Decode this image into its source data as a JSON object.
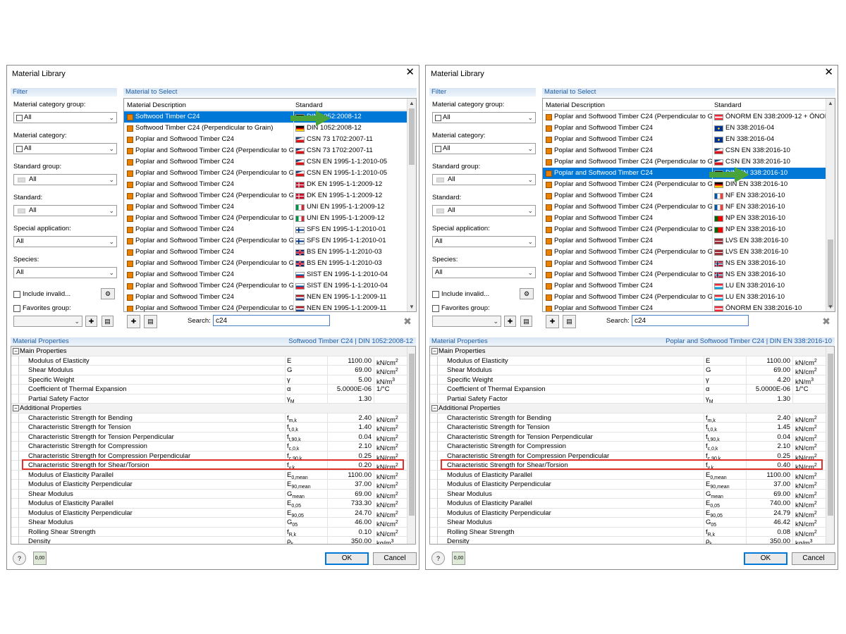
{
  "dialogs": [
    {
      "title": "Material Library",
      "filter": {
        "panel_title": "Filter",
        "labels": [
          "Material category group:",
          "Material category:",
          "Standard group:",
          "Standard:",
          "Special application:",
          "Species:"
        ],
        "values": [
          "All",
          "All",
          "All",
          "All",
          "All",
          "All"
        ],
        "include_invalid": "Include invalid...",
        "favorites_group": "Favorites group:"
      },
      "materials": {
        "panel_title": "Material to Select",
        "col_desc": "Material Description",
        "col_std": "Standard",
        "rows": [
          {
            "desc": "Softwood Timber C24",
            "std": "DIN 1052:2008-12",
            "flag": "DE",
            "sel": true
          },
          {
            "desc": "Softwood Timber C24 (Perpendicular to Grain)",
            "std": "DIN 1052:2008-12",
            "flag": "DE"
          },
          {
            "desc": "Poplar and Softwood Timber C24",
            "std": "CSN 73 1702:2007-11",
            "flag": "CZ"
          },
          {
            "desc": "Poplar and Softwood Timber C24 (Perpendicular to Gra",
            "std": "CSN 73 1702:2007-11",
            "flag": "CZ"
          },
          {
            "desc": "Poplar and Softwood Timber C24",
            "std": "CSN EN 1995-1-1:2010-05",
            "flag": "CZ"
          },
          {
            "desc": "Poplar and Softwood Timber C24 (Perpendicular to Gra",
            "std": "CSN EN 1995-1-1:2010-05",
            "flag": "CZ"
          },
          {
            "desc": "Poplar and Softwood Timber C24",
            "std": "DK EN 1995-1-1:2009-12",
            "flag": "DK"
          },
          {
            "desc": "Poplar and Softwood Timber C24 (Perpendicular to Gra",
            "std": "DK EN 1995-1-1:2009-12",
            "flag": "DK"
          },
          {
            "desc": "Poplar and Softwood Timber C24",
            "std": "UNI EN 1995-1-1:2009-12",
            "flag": "IT"
          },
          {
            "desc": "Poplar and Softwood Timber C24 (Perpendicular to Gra",
            "std": "UNI EN 1995-1-1:2009-12",
            "flag": "IT"
          },
          {
            "desc": "Poplar and Softwood Timber C24",
            "std": "SFS EN 1995-1-1:2010-01",
            "flag": "FI"
          },
          {
            "desc": "Poplar and Softwood Timber C24 (Perpendicular to Gra",
            "std": "SFS EN 1995-1-1:2010-01",
            "flag": "FI"
          },
          {
            "desc": "Poplar and Softwood Timber C24",
            "std": "BS EN 1995-1-1:2010-03",
            "flag": "GB"
          },
          {
            "desc": "Poplar and Softwood Timber C24 (Perpendicular to Gra",
            "std": "BS EN 1995-1-1:2010-03",
            "flag": "GB"
          },
          {
            "desc": "Poplar and Softwood Timber C24",
            "std": "SIST EN 1995-1-1:2010-04",
            "flag": "SI"
          },
          {
            "desc": "Poplar and Softwood Timber C24 (Perpendicular to Gra",
            "std": "SIST EN 1995-1-1:2010-04",
            "flag": "SI"
          },
          {
            "desc": "Poplar and Softwood Timber C24",
            "std": "NEN EN 1995-1-1:2009-11",
            "flag": "NL"
          },
          {
            "desc": "Poplar and Softwood Timber C24 (Perpendicular to Gra",
            "std": "NEN EN 1995-1-1:2009-11",
            "flag": "NL"
          }
        ]
      },
      "search_label": "Search:",
      "search_value": "c24",
      "props": {
        "panel_title": "Material Properties",
        "header_right": "Softwood Timber C24  |  DIN 1052:2008-12",
        "rows": [
          {
            "g": true,
            "name": "Main Properties"
          },
          {
            "name": "Modulus of Elasticity",
            "sym": "E",
            "val": "1100.00",
            "unit": "kN/cm²"
          },
          {
            "name": "Shear Modulus",
            "sym": "G",
            "val": "69.00",
            "unit": "kN/cm²"
          },
          {
            "name": "Specific Weight",
            "sym": "γ",
            "val": "5.00",
            "unit": "kN/m³"
          },
          {
            "name": "Coefficient of Thermal Expansion",
            "sym": "α",
            "val": "5.0000E-06",
            "unit": "1/°C"
          },
          {
            "name": "Partial Safety Factor",
            "sym": "γM",
            "val": "1.30",
            "unit": ""
          },
          {
            "g": true,
            "name": "Additional Properties"
          },
          {
            "name": "Characteristic Strength for Bending",
            "sym": "fm,k",
            "val": "2.40",
            "unit": "kN/cm²"
          },
          {
            "name": "Characteristic Strength for Tension",
            "sym": "ft,0,k",
            "val": "1.40",
            "unit": "kN/cm²"
          },
          {
            "name": "Characteristic Strength for Tension Perpendicular",
            "sym": "ft,90,k",
            "val": "0.04",
            "unit": "kN/cm²"
          },
          {
            "name": "Characteristic Strength for Compression",
            "sym": "fc,0,k",
            "val": "2.10",
            "unit": "kN/cm²"
          },
          {
            "name": "Characteristic Strength for Compression Perpendicular",
            "sym": "fc,90,k",
            "val": "0.25",
            "unit": "kN/cm²"
          },
          {
            "name": "Characteristic Strength for Shear/Torsion",
            "sym": "fv,k",
            "val": "0.20",
            "unit": "kN/cm²"
          },
          {
            "name": "Modulus of Elasticity Parallel",
            "sym": "E0,mean",
            "val": "1100.00",
            "unit": "kN/cm²"
          },
          {
            "name": "Modulus of Elasticity Perpendicular",
            "sym": "E90,mean",
            "val": "37.00",
            "unit": "kN/cm²"
          },
          {
            "name": "Shear Modulus",
            "sym": "Gmean",
            "val": "69.00",
            "unit": "kN/cm²"
          },
          {
            "name": "Modulus of Elasticity Parallel",
            "sym": "E0,05",
            "val": "733.30",
            "unit": "kN/cm²"
          },
          {
            "name": "Modulus of Elasticity Perpendicular",
            "sym": "E90,05",
            "val": "24.70",
            "unit": "kN/cm²"
          },
          {
            "name": "Shear Modulus",
            "sym": "G05",
            "val": "46.00",
            "unit": "kN/cm²"
          },
          {
            "name": "Rolling Shear Strength",
            "sym": "fR,k",
            "val": "0.10",
            "unit": "kN/cm²"
          },
          {
            "name": "Density",
            "sym": "ρk",
            "val": "350.00",
            "unit": "kg/m³"
          }
        ]
      },
      "ok": "OK",
      "cancel": "Cancel"
    },
    {
      "title": "Material Library",
      "filter": {
        "panel_title": "Filter",
        "labels": [
          "Material category group:",
          "Material category:",
          "Standard group:",
          "Standard:",
          "Special application:",
          "Species:"
        ],
        "values": [
          "All",
          "All",
          "All",
          "All",
          "All",
          "All"
        ],
        "include_invalid": "Include invalid...",
        "favorites_group": "Favorites group:"
      },
      "materials": {
        "panel_title": "Material to Select",
        "col_desc": "Material Description",
        "col_std": "Standard",
        "rows": [
          {
            "desc": "Poplar and Softwood Timber C24 (Perpendicular to Gra",
            "std": "ÖNORM EN 338:2009-12 + ÖNOR",
            "flag": "AT"
          },
          {
            "desc": "Poplar and Softwood Timber C24",
            "std": "EN 338:2016-04",
            "flag": "EU"
          },
          {
            "desc": "Poplar and Softwood Timber C24",
            "std": "EN 338:2016-04",
            "flag": "EU"
          },
          {
            "desc": "Poplar and Softwood Timber C24",
            "std": "CSN EN 338:2016-10",
            "flag": "CZ"
          },
          {
            "desc": "Poplar and Softwood Timber C24 (Perpendicular to Gra",
            "std": "CSN EN 338:2016-10",
            "flag": "CZ"
          },
          {
            "desc": "Poplar and Softwood Timber C24",
            "std": "DIN EN 338:2016-10",
            "flag": "DE",
            "sel": true
          },
          {
            "desc": "Poplar and Softwood Timber C24 (Perpendicular to Gra",
            "std": "DIN EN 338:2016-10",
            "flag": "DE"
          },
          {
            "desc": "Poplar and Softwood Timber C24",
            "std": "NF EN 338:2016-10",
            "flag": "FR"
          },
          {
            "desc": "Poplar and Softwood Timber C24 (Perpendicular to Gra",
            "std": "NF EN 338:2016-10",
            "flag": "FR"
          },
          {
            "desc": "Poplar and Softwood Timber C24",
            "std": "NP EN 338:2016-10",
            "flag": "PT"
          },
          {
            "desc": "Poplar and Softwood Timber C24 (Perpendicular to Gra",
            "std": "NP EN 338:2016-10",
            "flag": "PT"
          },
          {
            "desc": "Poplar and Softwood Timber C24",
            "std": "LVS EN 338:2016-10",
            "flag": "LV"
          },
          {
            "desc": "Poplar and Softwood Timber C24 (Perpendicular to Gra",
            "std": "LVS EN 338:2016-10",
            "flag": "LV"
          },
          {
            "desc": "Poplar and Softwood Timber C24",
            "std": "NS EN 338:2016-10",
            "flag": "NO"
          },
          {
            "desc": "Poplar and Softwood Timber C24 (Perpendicular to Gra",
            "std": "NS EN 338:2016-10",
            "flag": "NO"
          },
          {
            "desc": "Poplar and Softwood Timber C24",
            "std": "LU EN 338:2016-10",
            "flag": "LU"
          },
          {
            "desc": "Poplar and Softwood Timber C24 (Perpendicular to Gra",
            "std": "LU EN 338:2016-10",
            "flag": "LU"
          },
          {
            "desc": "Poplar and Softwood Timber C24",
            "std": "ÖNORM EN 338:2016-10",
            "flag": "AT"
          }
        ]
      },
      "search_label": "Search:",
      "search_value": "c24",
      "props": {
        "panel_title": "Material Properties",
        "header_right": "Poplar and Softwood Timber C24  |  DIN EN 338:2016-10",
        "rows": [
          {
            "g": true,
            "name": "Main Properties"
          },
          {
            "name": "Modulus of Elasticity",
            "sym": "E",
            "val": "1100.00",
            "unit": "kN/cm²"
          },
          {
            "name": "Shear Modulus",
            "sym": "G",
            "val": "69.00",
            "unit": "kN/cm²"
          },
          {
            "name": "Specific Weight",
            "sym": "γ",
            "val": "4.20",
            "unit": "kN/m³"
          },
          {
            "name": "Coefficient of Thermal Expansion",
            "sym": "α",
            "val": "5.0000E-06",
            "unit": "1/°C"
          },
          {
            "name": "Partial Safety Factor",
            "sym": "γM",
            "val": "1.30",
            "unit": ""
          },
          {
            "g": true,
            "name": "Additional Properties"
          },
          {
            "name": "Characteristic Strength for Bending",
            "sym": "fm,k",
            "val": "2.40",
            "unit": "kN/cm²"
          },
          {
            "name": "Characteristic Strength for Tension",
            "sym": "ft,0,k",
            "val": "1.45",
            "unit": "kN/cm²"
          },
          {
            "name": "Characteristic Strength for Tension Perpendicular",
            "sym": "ft,90,k",
            "val": "0.04",
            "unit": "kN/cm²"
          },
          {
            "name": "Characteristic Strength for Compression",
            "sym": "fc,0,k",
            "val": "2.10",
            "unit": "kN/cm²"
          },
          {
            "name": "Characteristic Strength for Compression Perpendicular",
            "sym": "fc,90,k",
            "val": "0.25",
            "unit": "kN/cm²"
          },
          {
            "name": "Characteristic Strength for Shear/Torsion",
            "sym": "fv,k",
            "val": "0.40",
            "unit": "kN/cm²"
          },
          {
            "name": "Modulus of Elasticity Parallel",
            "sym": "E0,mean",
            "val": "1100.00",
            "unit": "kN/cm²"
          },
          {
            "name": "Modulus of Elasticity Perpendicular",
            "sym": "E90,mean",
            "val": "37.00",
            "unit": "kN/cm²"
          },
          {
            "name": "Shear Modulus",
            "sym": "Gmean",
            "val": "69.00",
            "unit": "kN/cm²"
          },
          {
            "name": "Modulus of Elasticity Parallel",
            "sym": "E0,05",
            "val": "740.00",
            "unit": "kN/cm²"
          },
          {
            "name": "Modulus of Elasticity Perpendicular",
            "sym": "E90,05",
            "val": "24.79",
            "unit": "kN/cm²"
          },
          {
            "name": "Shear Modulus",
            "sym": "G05",
            "val": "46.42",
            "unit": "kN/cm²"
          },
          {
            "name": "Rolling Shear Strength",
            "sym": "fR,k",
            "val": "0.08",
            "unit": "kN/cm²"
          },
          {
            "name": "Density",
            "sym": "ρk",
            "val": "350.00",
            "unit": "kg/m³"
          }
        ]
      },
      "ok": "OK",
      "cancel": "Cancel"
    }
  ],
  "colors": {
    "selection": "#0078d7",
    "highlight": "#e0322b",
    "arrow": "#4aa33a",
    "material": "#e88000",
    "panel_title": "#1f5fa8"
  }
}
